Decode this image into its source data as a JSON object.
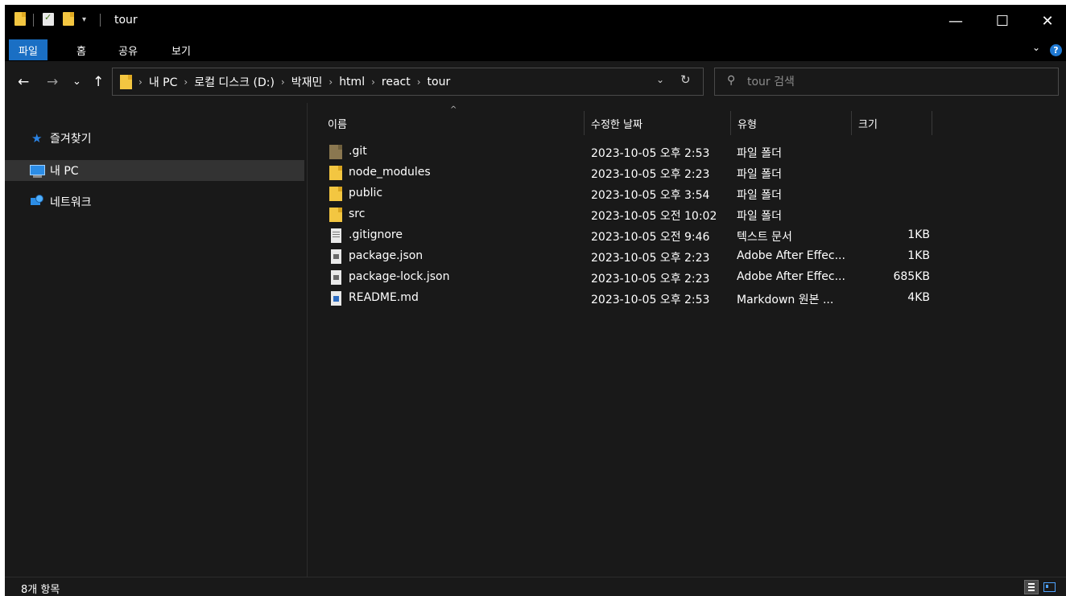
{
  "window": {
    "title": "tour",
    "quick_access": {
      "dropdown_glyph": "▾"
    },
    "controls": {
      "minimize": "—",
      "maximize": "☐",
      "close": "✕"
    }
  },
  "ribbon": {
    "tabs": [
      {
        "label": "파일",
        "active": true
      },
      {
        "label": "홈",
        "active": false
      },
      {
        "label": "공유",
        "active": false
      },
      {
        "label": "보기",
        "active": false
      }
    ],
    "expand_glyph": "⌄",
    "help_glyph": "?"
  },
  "nav": {
    "back": "←",
    "forward": "→",
    "recent": "⌄",
    "up": "↑",
    "address": {
      "crumbs": [
        "내 PC",
        "로컬 디스크 (D:)",
        "박재민",
        "html",
        "react",
        "tour"
      ],
      "separator": "›",
      "dropdown_glyph": "⌄",
      "refresh_glyph": "↻"
    },
    "search": {
      "icon_glyph": "⚲",
      "placeholder": "tour 검색",
      "value": ""
    }
  },
  "sidebar": {
    "items": [
      {
        "label": "즐겨찾기",
        "icon": "star-icon",
        "selected": false
      },
      {
        "label": "내 PC",
        "icon": "computer-icon",
        "selected": true
      },
      {
        "label": "네트워크",
        "icon": "network-icon",
        "selected": false
      }
    ],
    "star_glyph": "★"
  },
  "files": {
    "sort_glyph": "^",
    "columns": {
      "name": "이름",
      "date": "수정한 날짜",
      "type": "유형",
      "size": "크기"
    },
    "rows": [
      {
        "name": ".git",
        "date": "2023-10-05 오후 2:53",
        "type": "파일 폴더",
        "size": "",
        "icon": "git-folder-icon"
      },
      {
        "name": "node_modules",
        "date": "2023-10-05 오후 2:23",
        "type": "파일 폴더",
        "size": "",
        "icon": "folder-icon"
      },
      {
        "name": "public",
        "date": "2023-10-05 오후 3:54",
        "type": "파일 폴더",
        "size": "",
        "icon": "folder-icon"
      },
      {
        "name": "src",
        "date": "2023-10-05 오전 10:02",
        "type": "파일 폴더",
        "size": "",
        "icon": "folder-icon"
      },
      {
        "name": ".gitignore",
        "date": "2023-10-05 오전 9:46",
        "type": "텍스트 문서",
        "size": "1KB",
        "icon": "text-file-icon"
      },
      {
        "name": "package.json",
        "date": "2023-10-05 오후 2:23",
        "type": "Adobe After Effec...",
        "size": "1KB",
        "icon": "json-file-icon"
      },
      {
        "name": "package-lock.json",
        "date": "2023-10-05 오후 2:23",
        "type": "Adobe After Effec...",
        "size": "685KB",
        "icon": "json-file-icon"
      },
      {
        "name": "README.md",
        "date": "2023-10-05 오후 2:53",
        "type": "Markdown 원본 ...",
        "size": "4KB",
        "icon": "markdown-file-icon"
      }
    ]
  },
  "status": {
    "item_count": "8개 항목"
  }
}
